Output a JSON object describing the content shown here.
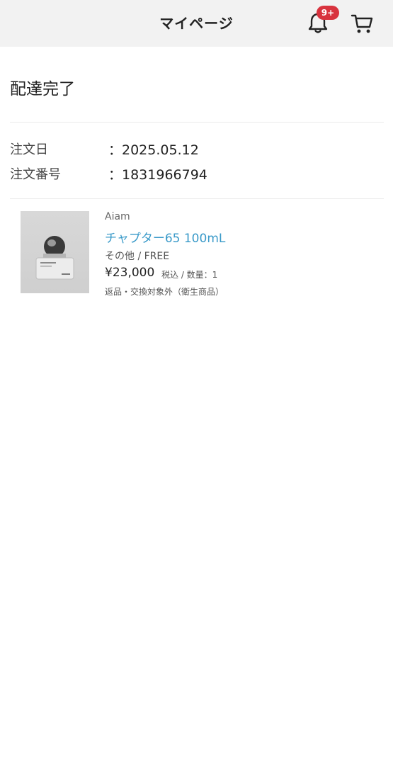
{
  "header": {
    "title": "マイページ",
    "notification_badge": "9+"
  },
  "order": {
    "status": "配達完了",
    "date_label": "注文日",
    "date_value": "：2025.05.12",
    "number_label": "注文番号",
    "number_value": "：1831966794"
  },
  "product": {
    "brand": "Aiam",
    "name": "チャプター65 100mL",
    "variant": "その他 / FREE",
    "price": "¥23,000",
    "tax_qty": "税込 / 数量：1",
    "note": "返品・交換対象外（衛生商品）"
  },
  "colors": {
    "accent_link": "#3a9ac9",
    "badge": "#d8333e",
    "header_bg": "#f2f2f2"
  }
}
